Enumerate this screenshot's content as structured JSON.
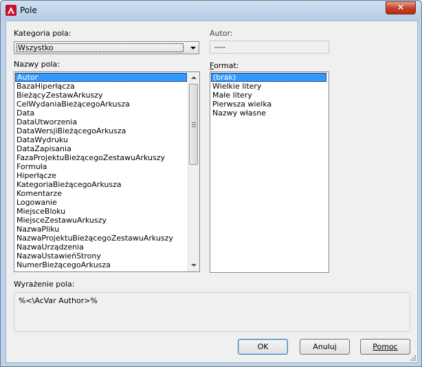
{
  "window": {
    "title": "Pole",
    "close_glyph": "✕"
  },
  "category": {
    "label": "Kategoria pola:",
    "value": "Wszystko"
  },
  "author": {
    "label": "Autor:",
    "value": "----"
  },
  "field_names": {
    "label": "Nazwy pola:",
    "items": [
      "Autor",
      "BazaHiperłącza",
      "BieżącyZestawArkuszy",
      "CelWydaniaBieżącegoArkusza",
      "Data",
      "DataUtworzenia",
      "DataWersjiBieżącegoArkusza",
      "DataWydruku",
      "DataZapisania",
      "FazaProjektuBieżącegoZestawuArkuszy",
      "Formuła",
      "Hiperłącze",
      "KategoriaBieżącegoArkusza",
      "Komentarze",
      "Logowanie",
      "MiejsceBloku",
      "MiejsceZestawuArkuszy",
      "NazwaPliku",
      "NazwaProjektuBieżącegoZestawuArkuszy",
      "NazwaUrządzenia",
      "NazwaUstawieńStrony",
      "NumerBieżącegoArkusza"
    ],
    "selected_index": 0
  },
  "format": {
    "label": "Format:",
    "items": [
      "(brak)",
      "Wielkie litery",
      "Małe litery",
      "Pierwsza wielka",
      "Nazwy własne"
    ],
    "selected_index": 0
  },
  "expression": {
    "label": "Wyrażenie pola:",
    "value": "%<\\AcVar Author>%"
  },
  "buttons": {
    "ok": "OK",
    "cancel": "Anuluj",
    "help": "Pomoc"
  },
  "colors": {
    "selection": "#3399ff",
    "title_bar": "#bcd3ea",
    "close": "#c7432c"
  },
  "icons": {
    "app": "autocad-logo-icon",
    "close": "close-icon"
  }
}
